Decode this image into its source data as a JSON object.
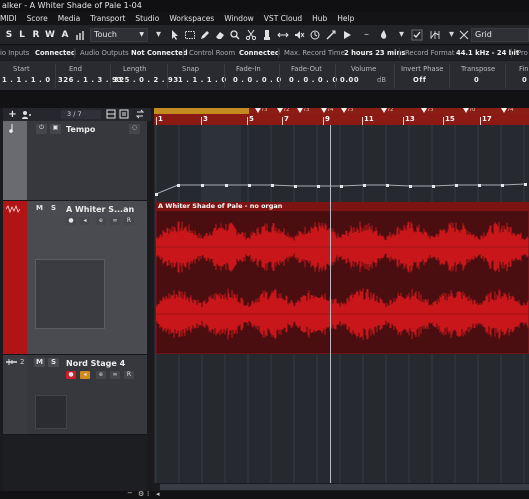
{
  "window": {
    "title": "alker - A Whiter Shade of Pale 1-04"
  },
  "menu": [
    "MIDI",
    "Score",
    "Media",
    "Transport",
    "Studio",
    "Workspaces",
    "Window",
    "VST Cloud",
    "Hub",
    "Help"
  ],
  "toolbar": {
    "automation_buttons": [
      "S",
      "L",
      "R",
      "W",
      "A"
    ],
    "automation_mode": "Touch",
    "snap_mode": "Grid"
  },
  "status": {
    "audio_inputs_label": "io Inputs",
    "audio_inputs_value": "Connected",
    "audio_outputs_label": "Audio Outputs",
    "audio_outputs_value": "Not Connected",
    "control_room_label": "Control Room",
    "control_room_value": "Connected",
    "max_record_label": "Max. Record Time",
    "max_record_value": "2 hours 23 mins",
    "record_format_label": "Record Format",
    "record_format_value": "44.1 kHz - 24 bit",
    "project_frame_label": "Pro"
  },
  "info_line": {
    "fields": [
      {
        "label": "Start",
        "value": "1 . 1 . 1 .   0"
      },
      {
        "label": "End",
        "value": "326 . 1 . 3 . 93"
      },
      {
        "label": "Length",
        "value": "325 . 0 . 2 . 93"
      },
      {
        "label": "Snap",
        "value": "1 . 1 . 1 .   0"
      },
      {
        "label": "Fade-In",
        "value": "0 . 0 . 0 .   0"
      },
      {
        "label": "Fade-Out",
        "value": "0 . 0 . 0 .   0"
      },
      {
        "label": "Volume",
        "value": "0.00",
        "unit": "dB"
      },
      {
        "label": "Invert Phase",
        "value": "Off"
      },
      {
        "label": "Transpose",
        "value": "0"
      },
      {
        "label": "Fin",
        "value": "0"
      }
    ]
  },
  "track_list_header": {
    "visible_count": "3 / 7"
  },
  "tracks": [
    {
      "name": "Tempo"
    },
    {
      "name": "A Whiter S...an",
      "event_name": "A Whiter Shade of Pale - no organ",
      "color": "#b01414"
    },
    {
      "number": "2",
      "name": "Nord Stage 4"
    }
  ],
  "ruler": {
    "bar_numbers": [
      "1",
      "3",
      "5",
      "7",
      "9",
      "11",
      "13",
      "15",
      "17"
    ],
    "tempo_marks": [
      "73",
      "74",
      "73",
      "72",
      "73",
      "72",
      "73",
      "74",
      "73",
      "72",
      "73",
      "70",
      "74"
    ]
  },
  "colors": {
    "audio_track": "#b01414",
    "ruler_red": "#8c1a14",
    "loop_gold": "#c28a1f",
    "waveform": "#c8161a",
    "event_background": "#4a0e10"
  }
}
